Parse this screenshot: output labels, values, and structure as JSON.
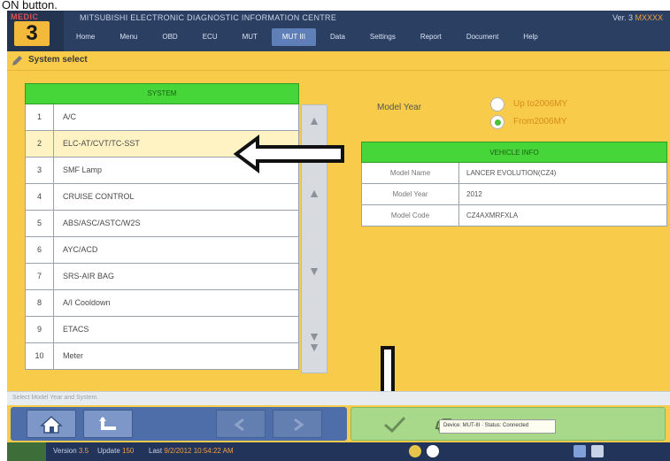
{
  "caption_fragment": "ON button.",
  "app": {
    "brand_word": "MEDIC",
    "brand_number": "3",
    "title": "MITSUBISHI ELECTRONIC DIAGNOSTIC INFORMATION CENTRE",
    "window_info_label": "Ver. 3",
    "window_info_value": "MXXXX",
    "tabs": [
      {
        "label": "Home"
      },
      {
        "label": "Menu"
      },
      {
        "label": "OBD"
      },
      {
        "label": "ECU"
      },
      {
        "label": "MUT"
      },
      {
        "label": "MUT III",
        "active": true
      },
      {
        "label": "Data"
      },
      {
        "label": "Settings"
      },
      {
        "label": "Report"
      },
      {
        "label": "Document"
      },
      {
        "label": "Help"
      }
    ]
  },
  "screen": {
    "title": "System select"
  },
  "systems": {
    "header": "SYSTEM",
    "items": [
      {
        "num": "1",
        "name": "A/C"
      },
      {
        "num": "2",
        "name": "ELC-AT/CVT/TC-SST",
        "selected": true
      },
      {
        "num": "3",
        "name": "SMF Lamp"
      },
      {
        "num": "4",
        "name": "CRUISE CONTROL"
      },
      {
        "num": "5",
        "name": "ABS/ASC/ASTC/W2S"
      },
      {
        "num": "6",
        "name": "AYC/ACD"
      },
      {
        "num": "7",
        "name": "SRS-AIR BAG"
      },
      {
        "num": "8",
        "name": "A/I Cooldown"
      },
      {
        "num": "9",
        "name": "ETACS"
      },
      {
        "num": "10",
        "name": "Meter"
      }
    ]
  },
  "model_year": {
    "label": "Model Year",
    "options": [
      {
        "label": "Up to2006MY",
        "checked": false
      },
      {
        "label": "From2006MY",
        "checked": true
      }
    ]
  },
  "vehicle_info": {
    "header": "VEHICLE INFO",
    "rows": [
      {
        "key": "Model Name",
        "value": "LANCER EVOLUTION(CZ4)"
      },
      {
        "key": "Model Year",
        "value": "2012"
      },
      {
        "key": "Model Code",
        "value": "CZ4AXMRFXLA"
      }
    ]
  },
  "status_strip": {
    "text": "Select Model Year and System."
  },
  "taskbar": {
    "version_label": "Version",
    "version": "3.5",
    "update_label": "Update",
    "update": "150",
    "last_label": "Last",
    "last": "9/2/2012 10:54:22 AM"
  },
  "tray_popup": {
    "text": "Device: MUT-III · Status: Connected"
  },
  "colors": {
    "background": "#f8cc4a",
    "header_green": "#47d63a",
    "titlebar": "#2b3f63",
    "nav_blue": "#4d6ea8",
    "action_green": "#a8d98a",
    "option_orange": "#d78b1d"
  },
  "icons": {
    "home": "home-icon",
    "back": "back-arrow-icon",
    "ok": "checkmark-icon",
    "vehicle": "vehicle-icon",
    "scroll_up": "chevron-up-icon",
    "scroll_down": "chevron-down-icon"
  }
}
